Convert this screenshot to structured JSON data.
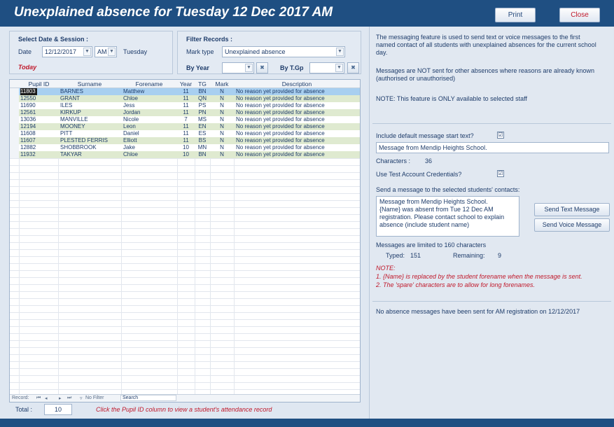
{
  "window": {
    "title": "Unexplained absence for Tuesday 12 Dec 2017 AM",
    "print_label": "Print",
    "close_label": "Close"
  },
  "session": {
    "heading": "Select Date & Session :",
    "date_label": "Date",
    "date_value": "12/12/2017",
    "session_value": "AM",
    "day": "Tuesday",
    "today_label": "Today"
  },
  "filter": {
    "heading": "Filter Records :",
    "mark_type_label": "Mark type",
    "mark_type_value": "Unexplained absence",
    "by_year_label": "By Year",
    "by_year_value": "",
    "by_tgp_label": "By T.Gp",
    "by_tgp_value": ""
  },
  "table": {
    "columns": [
      "Pupil ID",
      "Surname",
      "Forename",
      "Year",
      "TG",
      "Mark",
      "Description"
    ],
    "rows": [
      [
        "11803",
        "BARNES",
        "Matthew",
        "11",
        "BN",
        "N",
        "No reason yet provided for absence"
      ],
      [
        "12550",
        "GRANT",
        "Chloe",
        "11",
        "QN",
        "N",
        "No reason yet provided for absence"
      ],
      [
        "11690",
        "ILES",
        "Jess",
        "11",
        "PS",
        "N",
        "No reason yet provided for absence"
      ],
      [
        "12561",
        "KIRKUP",
        "Jordan",
        "11",
        "PN",
        "N",
        "No reason yet provided for absence"
      ],
      [
        "13036",
        "MANVILLE",
        "Nicole",
        "7",
        "MS",
        "N",
        "No reason yet provided for absence"
      ],
      [
        "12194",
        "MOONEY",
        "Leon",
        "11",
        "EN",
        "N",
        "No reason yet provided for absence"
      ],
      [
        "11608",
        "PITT",
        "Daniel",
        "11",
        "ES",
        "N",
        "No reason yet provided for absence"
      ],
      [
        "11607",
        "PLESTED FERRIS",
        "Elliott",
        "11",
        "BS",
        "N",
        "No reason yet provided for absence"
      ],
      [
        "12882",
        "SHOBBROOK",
        "Jake",
        "10",
        "MN",
        "N",
        "No reason yet provided for absence"
      ],
      [
        "11932",
        "TAKYAR",
        "Chloe",
        "10",
        "BN",
        "N",
        "No reason yet provided for absence"
      ]
    ],
    "colors": {
      "selected_row": "#a8cff0",
      "alt_row": "#dfead0",
      "plain_row": "#ffffff"
    },
    "nav": {
      "record_label": "Record: ",
      "first": "⏮",
      "prev": "◂",
      "next": "▸",
      "last": "⏭",
      "no_filter": "No Filter",
      "search": "Search"
    }
  },
  "footer": {
    "total_label": "Total :",
    "total_value": "10",
    "hint": "Click the Pupil ID column to view a student's attendance record"
  },
  "info": {
    "p1": "The messaging feature is used to send text or voice messages to the first named contact of all students with unexplained absences for the current school day.",
    "p2": "Messages are NOT sent for other absences where reasons are already known (authorised or unauthorised)",
    "p3": "NOTE: This feature is ONLY available to selected staff"
  },
  "message": {
    "include_default_label": "Include default message start text?",
    "include_default_checked": "☑",
    "default_text": "Message from  Mendip Heights School.",
    "characters_label": "Characters :",
    "characters_value": "36",
    "test_credentials_label": "Use Test Account Credentials?",
    "test_credentials_checked": "☑",
    "send_heading": "Send a message to the selected students' contacts:",
    "body_line1": "Message from  Mendip Heights School.",
    "body_line2": "{Name} was absent from Tue 12 Dec AM",
    "body_line3": "registration. Please contact school to explain",
    "body_line4": "absence (include student name)",
    "send_text_label": "Send Text Message",
    "send_voice_label": "Send Voice Message",
    "limit_text": "Messages are limited to 160 characters",
    "typed_label": "Typed:",
    "typed_value": "151",
    "remaining_label": "Remaining:",
    "remaining_value": "9",
    "note_heading": "NOTE:",
    "note1": "1. {Name} is replaced by the student forename when the message is sent.",
    "note2": "2. The 'spare' characters are to allow for long forenames."
  },
  "status": {
    "text": "No absence messages have been sent for AM registration on 12/12/2017"
  }
}
